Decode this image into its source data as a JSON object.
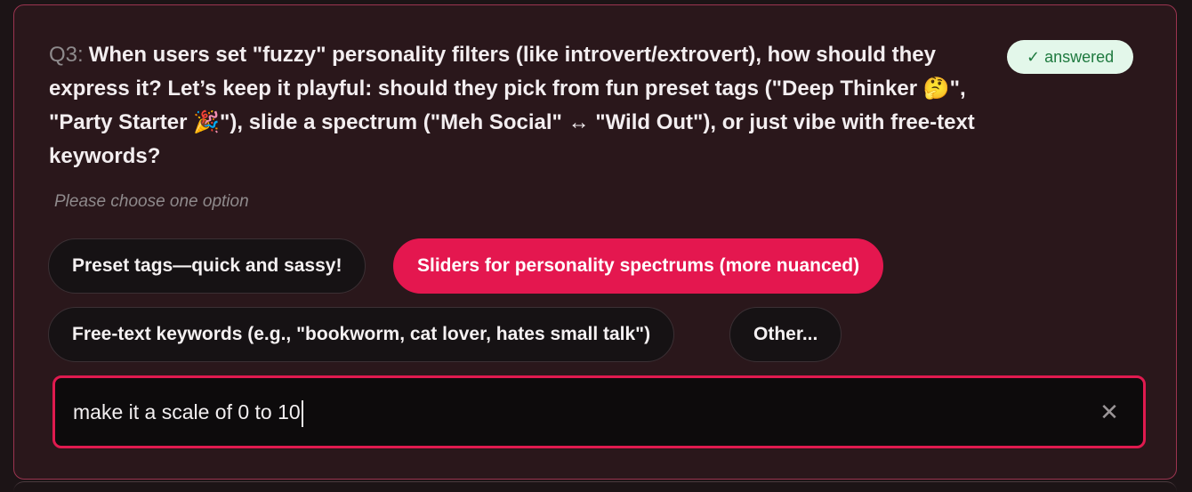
{
  "question": {
    "number": "Q3:",
    "text": "When users set \"fuzzy\" personality filters (like introvert/extrovert), how should they express it? Let’s keep it playful: should they pick from fun preset tags (\"Deep Thinker 🤔\", \"Party Starter 🎉\"), slide a spectrum (\"Meh Social\" ↔ \"Wild Out\"), or just vibe with free-text keywords?"
  },
  "status_badge": "✓ answered",
  "hint": "Please choose one option",
  "options": [
    {
      "label": "Preset tags—quick and sassy!",
      "selected": false
    },
    {
      "label": "Sliders for personality spectrums (more nuanced)",
      "selected": true
    },
    {
      "label": "Free-text keywords (e.g., \"bookworm, cat lover, hates small talk\")",
      "selected": false
    },
    {
      "label": "Other...",
      "selected": false
    }
  ],
  "other_input": {
    "value": "make it a scale of 0 to 10"
  },
  "icons": {
    "clear": "close-icon",
    "check": "check-icon"
  },
  "colors": {
    "accent": "#e4174f",
    "card_border": "#9b3450",
    "badge_bg": "#e3f7ea",
    "badge_text": "#1f7a3f"
  }
}
